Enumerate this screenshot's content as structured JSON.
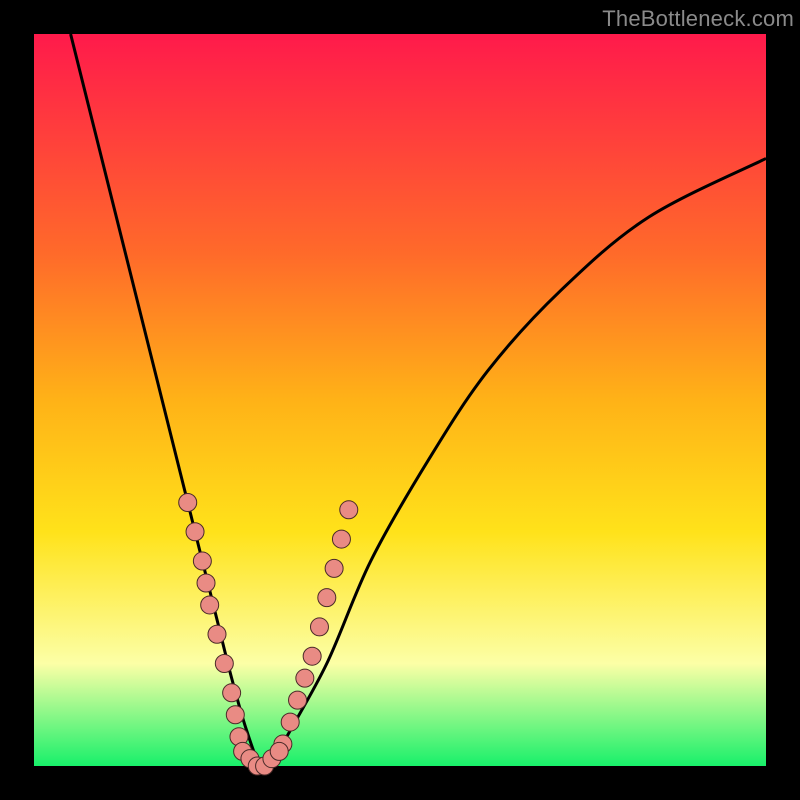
{
  "watermark_text": "TheBottleneck.com",
  "colors": {
    "black_border": "#000000",
    "grad_top": "#ff1a4b",
    "grad_mid1": "#ff6a2a",
    "grad_mid2": "#ffb217",
    "grad_mid3": "#ffe21a",
    "grad_mid4": "#fcffa6",
    "grad_bottom": "#18f06a",
    "curve": "#000000",
    "dot_fill": "#e98b84",
    "dot_stroke": "#4a2a28"
  },
  "chart_data": {
    "type": "line",
    "title": "",
    "xlabel": "",
    "ylabel": "",
    "xlim": [
      0,
      100
    ],
    "ylim": [
      0,
      100
    ],
    "series": [
      {
        "name": "bottleneck-curve",
        "x": [
          5,
          8,
          12,
          16,
          20,
          23,
          25,
          27,
          29,
          31,
          33,
          34,
          40,
          46,
          54,
          62,
          72,
          84,
          100
        ],
        "y": [
          100,
          88,
          72,
          56,
          40,
          28,
          20,
          12,
          5,
          0,
          0,
          3,
          14,
          28,
          42,
          54,
          65,
          75,
          83
        ]
      }
    ],
    "dot_clusters": [
      {
        "name": "left-branch-dots",
        "x": [
          21,
          22,
          23,
          23.5,
          24,
          25,
          26,
          27,
          27.5,
          28
        ],
        "y": [
          36,
          32,
          28,
          25,
          22,
          18,
          14,
          10,
          7,
          4
        ]
      },
      {
        "name": "right-branch-dots",
        "x": [
          34,
          35,
          36,
          37,
          38,
          39,
          40,
          41,
          42,
          43
        ],
        "y": [
          3,
          6,
          9,
          12,
          15,
          19,
          23,
          27,
          31,
          35
        ]
      },
      {
        "name": "trough-dots",
        "x": [
          28.5,
          29.5,
          30.5,
          31.5,
          32.5,
          33.5
        ],
        "y": [
          2,
          1,
          0,
          0,
          1,
          2
        ]
      }
    ]
  }
}
